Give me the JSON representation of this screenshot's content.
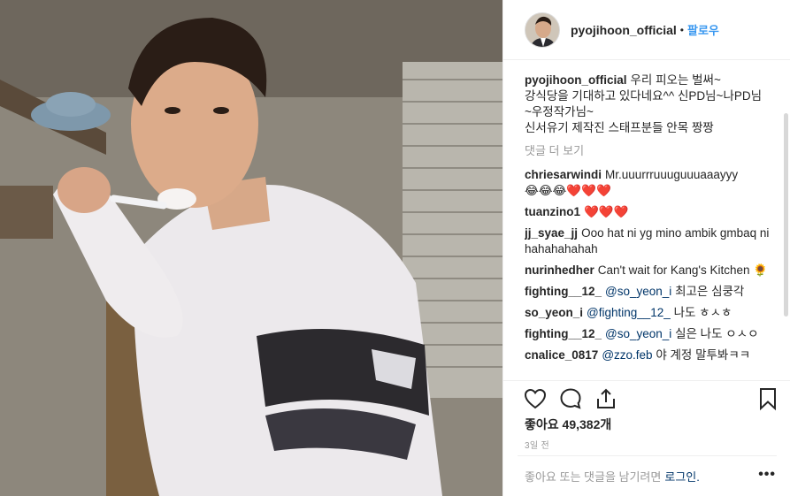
{
  "post": {
    "username": "pyojihoon_official",
    "dot": "•",
    "follow_label": "팔로우",
    "caption_lines": [
      "우리 피오는 벌써~",
      "강식당을 기대하고 있다네요^^ 신PD님~나PD님",
      "~우정작가님~",
      "신서유기 제작진 스태프분들 안목 짱짱"
    ],
    "view_all_comments": "댓글 더 보기",
    "comments": [
      {
        "user": "chriesarwindi",
        "text": "Mr.uuurrruuuguuuaaayyy",
        "text2": "😂😂😂❤️❤️❤️"
      },
      {
        "user": "tuanzino1",
        "text": "❤️❤️❤️"
      },
      {
        "user": "jj_syae_jj",
        "text": "Ooo hat ni yg mino ambik gmbaq ni hahahahahah"
      },
      {
        "user": "nurinhedher",
        "text": "Can't wait for Kang's Kitchen 🌻"
      },
      {
        "user": "fighting__12_",
        "mention": "@so_yeon_i",
        "text": "최고은 심쿵각"
      },
      {
        "user": "so_yeon_i",
        "mention": "@fighting__12_",
        "text": "나도 ㅎㅅㅎ"
      },
      {
        "user": "fighting__12_",
        "mention": "@so_yeon_i",
        "text": "실은 나도 ㅇㅅㅇ"
      },
      {
        "user": "cnalice_0817",
        "mention": "@zzo.feb",
        "text": "야 계정 말투봐ㅋㅋ"
      }
    ],
    "likes": "좋아요 49,382개",
    "time_ago": "3일 전",
    "login_prompt": "좋아요 또는 댓글을 남기려면",
    "login_link": "로그인.",
    "more_label": "•••"
  },
  "icons": {
    "like": "heart-icon",
    "comment": "comment-icon",
    "share": "share-icon",
    "save": "bookmark-icon"
  }
}
